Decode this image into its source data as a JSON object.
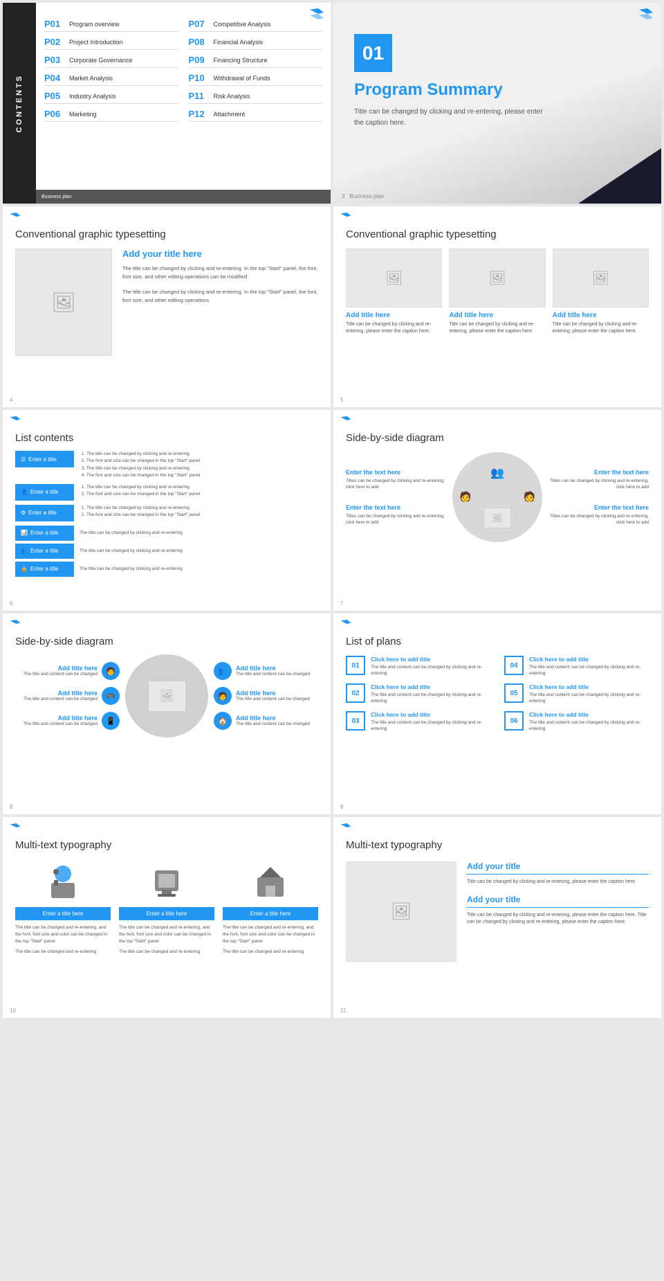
{
  "slides": {
    "slide1": {
      "sidebar_label": "CONTENTS",
      "logo": "≫",
      "items": [
        {
          "num": "P01",
          "title": "Program overview"
        },
        {
          "num": "P07",
          "title": "Competitive Analysis"
        },
        {
          "num": "P02",
          "title": "Project Introduction"
        },
        {
          "num": "P08",
          "title": "Financial Analysis"
        },
        {
          "num": "P03",
          "title": "Corporate Governance"
        },
        {
          "num": "P09",
          "title": "Financing Structure"
        },
        {
          "num": "P04",
          "title": "Market Analysis"
        },
        {
          "num": "P10",
          "title": "Withdrawal of Funds"
        },
        {
          "num": "P05",
          "title": "Industry Analysis"
        },
        {
          "num": "P11",
          "title": "Risk Analysis"
        },
        {
          "num": "P06",
          "title": "Marketing"
        },
        {
          "num": "P12",
          "title": "Attachment"
        }
      ],
      "footer": "Business plan"
    },
    "slide2": {
      "num": "01",
      "title": "Program Summary",
      "desc": "Title can be changed by clicking and re-entering, please enter the caption here.",
      "logo": "≫",
      "page": "3",
      "footer": "Business plan"
    },
    "slide3": {
      "logo": "≫",
      "title": "Conventional graphic typesetting",
      "add_title": "Add your title here",
      "desc1": "The title can be changed by clicking and re-entering. In the top \"Start\" panel, the font, font size, and other editing operations can be modified",
      "desc2": "The title can be changed by clicking and re-entering. In the top \"Start\" panel, the font, font size, and other editing operations",
      "page": "4"
    },
    "slide4": {
      "logo": "≫",
      "title": "Conventional graphic typesetting",
      "columns": [
        {
          "title": "Add title here",
          "desc": "Title can be changed by clicking and re-entering, please enter the caption here."
        },
        {
          "title": "Add title here",
          "desc": "Title can be changed by clicking and re-entering, please enter the caption here."
        },
        {
          "title": "Add title here",
          "desc": "Title can be changed by clicking and re-entering, please enter the caption here."
        }
      ],
      "page": "5"
    },
    "slide5": {
      "logo": "≫",
      "title": "List contents",
      "items": [
        {
          "label": "Enter a title",
          "icon": "☰",
          "items": [
            "The title can be changed by clicking and re-entering",
            "The font and size can be changed in the top \"Start\" panel",
            "The title can be changed by clicking and re-entering",
            "The font and size can be changed in the top \"Start\" panel"
          ]
        },
        {
          "label": "Enter a title",
          "icon": "👤",
          "items": [
            "The title can be changed by clicking and re-entering",
            "The font and size can be changed in the top \"Start\" panel"
          ]
        },
        {
          "label": "Enter a title",
          "icon": "⚙",
          "items": [
            "The title can be changed by clicking and re-entering",
            "The font and size can be changed in the top \"Start\" panel"
          ]
        },
        {
          "label": "Enter a title",
          "icon": "📊",
          "text": "The title can be changed by clicking and re-entering"
        },
        {
          "label": "Enter a title",
          "icon": "👥",
          "text": "The title can be changed by clicking and re-entering"
        },
        {
          "label": "Enter a title",
          "icon": "🔒",
          "text": "The title can be changed by clicking and re-entering"
        }
      ],
      "page": "6"
    },
    "slide6": {
      "logo": "≫",
      "title": "Side-by-side diagram",
      "left_items": [
        {
          "title": "Enter the text here",
          "desc": "Titles can be changed by clicking and re-entering, click here to add"
        },
        {
          "title": "Enter the text here",
          "desc": "Titles can be changed by clicking and re-entering, click here to add"
        }
      ],
      "right_items": [
        {
          "title": "Enter the text here",
          "desc": "Titles can be changed by clicking and re-entering, click here to add"
        },
        {
          "title": "Enter the text here",
          "desc": "Titles can be changed by clicking and re-entering, click here to add"
        }
      ],
      "page": "7"
    },
    "slide7": {
      "logo": "≫",
      "title": "Side-by-side diagram",
      "left_items": [
        {
          "title": "Add title here",
          "desc": "The title and content can be changed"
        },
        {
          "title": "Add title here",
          "desc": "The title and content can be changed"
        },
        {
          "title": "Add title here",
          "desc": "The title and content can be changed"
        }
      ],
      "right_items": [
        {
          "title": "Add title here",
          "desc": "The title and content can be changed"
        },
        {
          "title": "Add title here",
          "desc": "The title and content can be changed"
        },
        {
          "title": "Add title here",
          "desc": "The title and content can be changed"
        }
      ],
      "page": "8"
    },
    "slide8": {
      "logo": "≫",
      "title": "List of plans",
      "plans": [
        {
          "num": "01",
          "title": "Click here to add title",
          "desc": "The title and content can be changed by clicking and re-entering"
        },
        {
          "num": "04",
          "title": "Click here to add title",
          "desc": "The title and content can be changed by clicking and re-entering"
        },
        {
          "num": "02",
          "title": "Click here to add title",
          "desc": "The title and content can be changed by clicking and re-entering"
        },
        {
          "num": "05",
          "title": "Click here to add title",
          "desc": "The title and content can be changed by clicking and re-entering"
        },
        {
          "num": "03",
          "title": "Click here to add title",
          "desc": "The title and content can be changed by clicking and re-entering"
        },
        {
          "num": "06",
          "title": "Click here to add title",
          "desc": "The title and content can be changed by clicking and re-entering"
        }
      ],
      "page": "9"
    },
    "slide9": {
      "logo": "≫",
      "title": "Multi-text typography",
      "columns": [
        {
          "btn_label": "Enter a title here",
          "desc1": "The title can be changed and re-entering, and the font, font size and color can be changed in the top \"Start\" panel",
          "desc2": "The title can be changed and re-entering"
        },
        {
          "btn_label": "Enter a title here",
          "desc1": "The title can be changed and re-entering, and the font, font size and color can be changed in the top \"Start\" panel",
          "desc2": "The title can be changed and re-entering"
        },
        {
          "btn_label": "Enter a title here",
          "desc1": "The title can be changed and re-entering, and the font, font size and color can be changed in the top \"Start\" panel",
          "desc2": "The title can be changed and re-entering"
        }
      ],
      "page": "10"
    },
    "slide10": {
      "logo": "≫",
      "title": "Multi-text typography",
      "title1": "Add your title",
      "desc1": "Title can be changed by clicking and re-entering, please enter the caption here.",
      "title2": "Add your title",
      "desc2": "Title can be changed by clicking and re-entering, please enter the caption here. Title can be changed by clicking and re-entering, please enter the caption here.",
      "page": "11"
    }
  },
  "colors": {
    "blue": "#2196F3",
    "dark": "#1a1a2e",
    "gray": "#e8e8e8",
    "text": "#555555"
  }
}
